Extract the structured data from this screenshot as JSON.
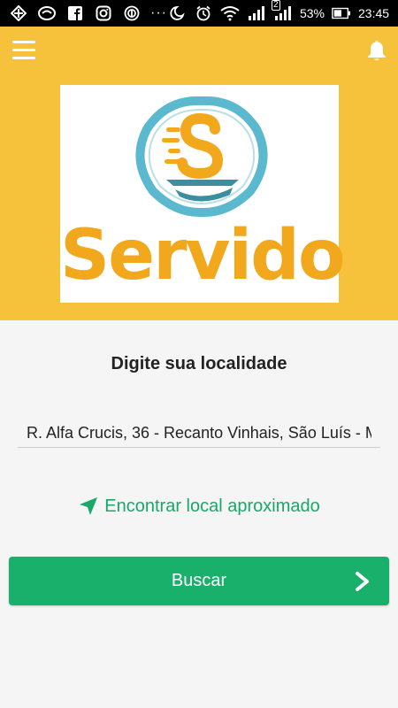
{
  "status_bar": {
    "battery_percent": "53%",
    "time": "23:45",
    "sim_slot": "2",
    "overflow": "···",
    "icons": [
      "bank-icon",
      "whatsapp-icon",
      "facebook-icon",
      "instagram-icon",
      "nfc-icon",
      "moon-icon",
      "alarm-icon",
      "wifi-icon",
      "signal-icon",
      "signal-icon",
      "battery-icon"
    ]
  },
  "header": {
    "background_color": "#f7c23b",
    "logo_text": "Servido"
  },
  "main": {
    "title": "Digite sua localidade",
    "location_value": "R. Alfa Crucis, 36 - Recanto Vinhais, São Luís - M",
    "find_location_label": "Encontrar local aproximado",
    "search_button_label": "Buscar"
  },
  "colors": {
    "accent_green": "#19b06c",
    "header_yellow": "#f7c23b",
    "logo_orange": "#f2a81c",
    "logo_teal": "#5ab9cf"
  }
}
